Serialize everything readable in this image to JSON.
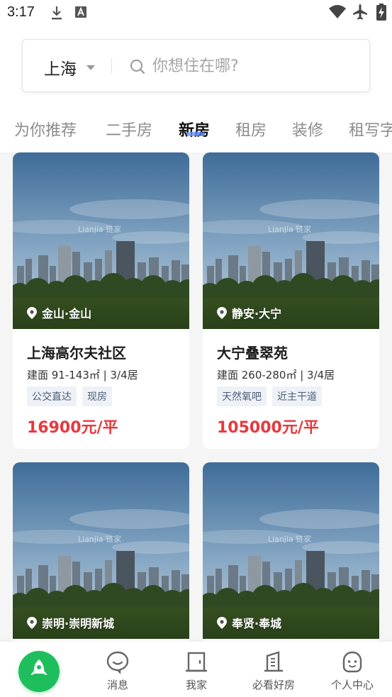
{
  "status_bar": {
    "time": "3:17",
    "icons": [
      "download-icon",
      "font-a-icon",
      "wifi-icon",
      "airplane-icon",
      "battery-charging-icon"
    ]
  },
  "search": {
    "city": "上海",
    "placeholder": "你想住在哪?"
  },
  "tabs": [
    {
      "label": "为你推荐",
      "active": false
    },
    {
      "label": "二手房",
      "active": false
    },
    {
      "label": "新房",
      "active": true
    },
    {
      "label": "租房",
      "active": false
    },
    {
      "label": "装修",
      "active": false
    },
    {
      "label": "租写字",
      "active": false
    }
  ],
  "listings": [
    {
      "location": "金山·金山",
      "title": "上海高尔夫社区",
      "spec": "建面 91-143㎡ | 3/4居",
      "tags": [
        "公交直达",
        "现房"
      ],
      "price": "16900元/平"
    },
    {
      "location": "静安·大宁",
      "title": "大宁叠翠苑",
      "spec": "建面 260-280㎡ | 3/4居",
      "tags": [
        "天然氧吧",
        "近主干道"
      ],
      "price": "105000元/平"
    },
    {
      "location": "崇明·崇明新城"
    },
    {
      "location": "奉贤·奉城"
    }
  ],
  "image_watermark": "Lianjia 链家",
  "bottom_nav": {
    "top_button_label": "TOP",
    "items": [
      {
        "label": "消息",
        "icon": "message-icon"
      },
      {
        "label": "我家",
        "icon": "home-icon"
      },
      {
        "label": "必看好房",
        "icon": "building-icon"
      },
      {
        "label": "个人中心",
        "icon": "profile-icon"
      }
    ]
  },
  "colors": {
    "price": "#e8383d",
    "tag_bg": "#eef2f7",
    "tag_text": "#4c5e7a",
    "accent_green": "#1ebe5d",
    "tab_indicator": "#3d6fe8"
  }
}
